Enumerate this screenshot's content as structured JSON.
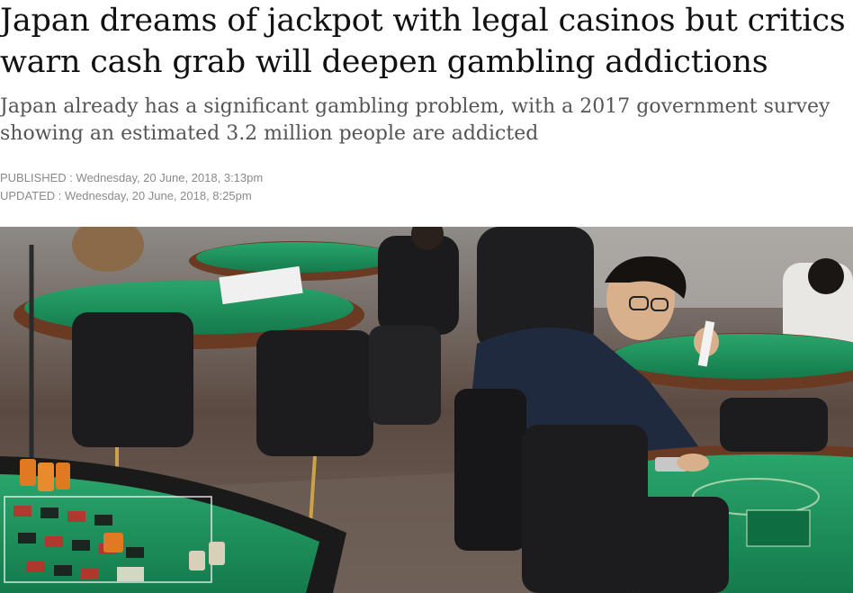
{
  "article": {
    "headline": "Japan dreams of jackpot with legal casinos but critics warn cash grab will deepen gambling addictions",
    "subheadline": "Japan already has a significant gambling problem, with a 2017 government survey showing an estimated 3.2 million people are addicted",
    "published_label": "PUBLISHED : ",
    "published_date": "Wednesday, 20 June, 2018, 3:13pm",
    "updated_label": "UPDATED : ",
    "updated_date": "Wednesday, 20 June, 2018, 8:25pm"
  },
  "photo": {
    "subject": "casino training room with green gaming tables, chips and a young man in glasses placing chips",
    "colors": {
      "felt": "#1e8c5a",
      "table_rim": "#6b3a22",
      "chairs": "#1c1c1f",
      "floor": "#7a6a5e",
      "chips": "#e07a22"
    }
  }
}
